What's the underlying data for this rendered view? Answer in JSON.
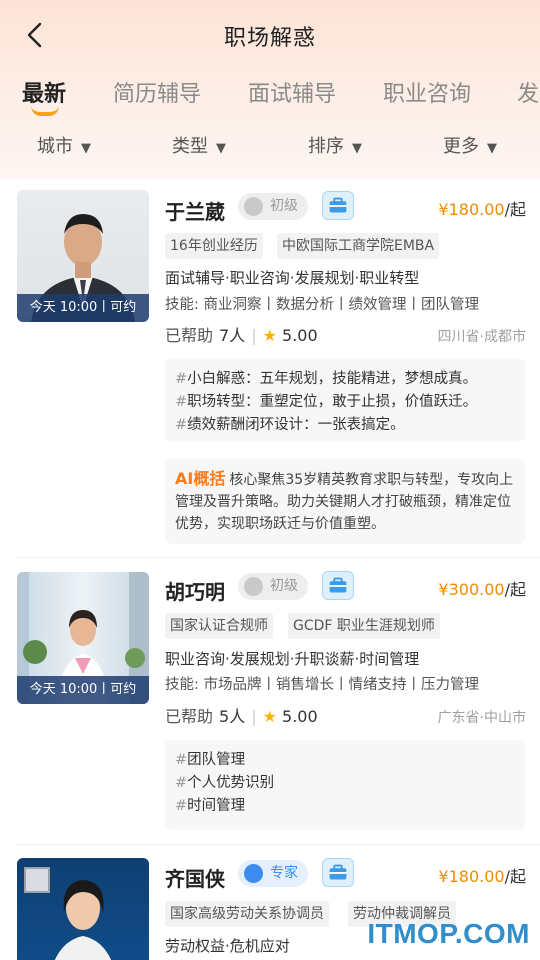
{
  "header": {
    "title": "职场解惑"
  },
  "tabs": [
    {
      "label": "最新",
      "active": true
    },
    {
      "label": "简历辅导"
    },
    {
      "label": "面试辅导"
    },
    {
      "label": "职业咨询"
    },
    {
      "label": "发"
    }
  ],
  "filters": [
    {
      "label": "城市"
    },
    {
      "label": "类型"
    },
    {
      "label": "排序"
    },
    {
      "label": "更多"
    }
  ],
  "mentors": [
    {
      "name": "于兰葳",
      "level": "初级",
      "price": "¥180.00",
      "price_unit": "/起",
      "availability": "今天 10:00丨可约",
      "tags": [
        "16年创业经历",
        "中欧国际工商学院EMBA"
      ],
      "services": "面试辅导·职业咨询·发展规划·职业转型",
      "skills": "技能: 商业洞察丨数据分析丨绩效管理丨团队管理",
      "helped_label": "已帮助",
      "helped_count": "7人",
      "rating": "5.00",
      "location": "四川省·成都市",
      "topics": [
        "小白解惑：五年规划，技能精进，梦想成真。",
        "职场转型：重塑定位，敢于止损，价值跃迁。",
        "绩效薪酬闭环设计：一张表搞定。"
      ],
      "ai_label": "AI概括",
      "ai_summary": "核心聚焦35岁精英教育求职与转型，专攻向上管理及晋升策略。助力关键期人才打破瓶颈，精准定位优势，实现职场跃迁与价值重塑。"
    },
    {
      "name": "胡巧明",
      "level": "初级",
      "price": "¥300.00",
      "price_unit": "/起",
      "availability": "今天 10:00丨可约",
      "tags": [
        "国家认证合规师",
        "GCDF 职业生涯规划师"
      ],
      "services": "职业咨询·发展规划·升职谈薪·时间管理",
      "skills": "技能: 市场品牌丨销售增长丨情绪支持丨压力管理",
      "helped_label": "已帮助",
      "helped_count": "5人",
      "rating": "5.00",
      "location": "广东省·中山市",
      "topics": [
        "团队管理",
        "个人优势识别",
        "时间管理"
      ]
    },
    {
      "name": "齐国侠",
      "level": "专家",
      "price": "¥180.00",
      "price_unit": "/起",
      "tags": [
        "国家高级劳动关系协调员",
        "劳动仲裁调解员"
      ],
      "services": "劳动权益·危机应对"
    }
  ],
  "watermark": "ITMOP.COM",
  "colors": {
    "accent": "#f7a21b",
    "price": "#f08c00",
    "expert": "#3d8df0",
    "ai": "#ff7a1a"
  }
}
